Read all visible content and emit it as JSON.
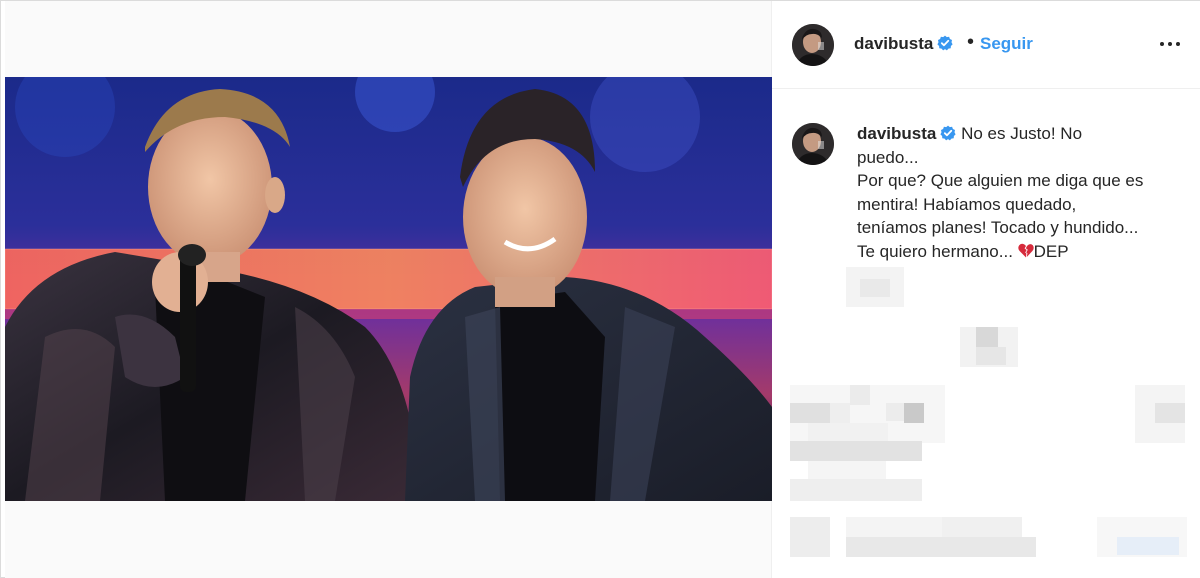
{
  "post": {
    "username": "davibusta",
    "follow_label": "Seguir",
    "separator": "•",
    "caption_lines": [
      "No es Justo! No",
      "puedo...",
      "Por que? Que alguien me diga que es",
      "mentira! Habíamos quedado,",
      "teníamos planes! Tocado y hundido...",
      "Te quiero hermano... "
    ],
    "caption_end": "DEP",
    "broken_heart_icon": "broken-heart-icon"
  },
  "icons": {
    "verified": "verified-badge-icon",
    "more": "more-options-icon"
  },
  "colors": {
    "follow": "#3897f0",
    "verified": "#3897f0",
    "text": "#262626"
  }
}
